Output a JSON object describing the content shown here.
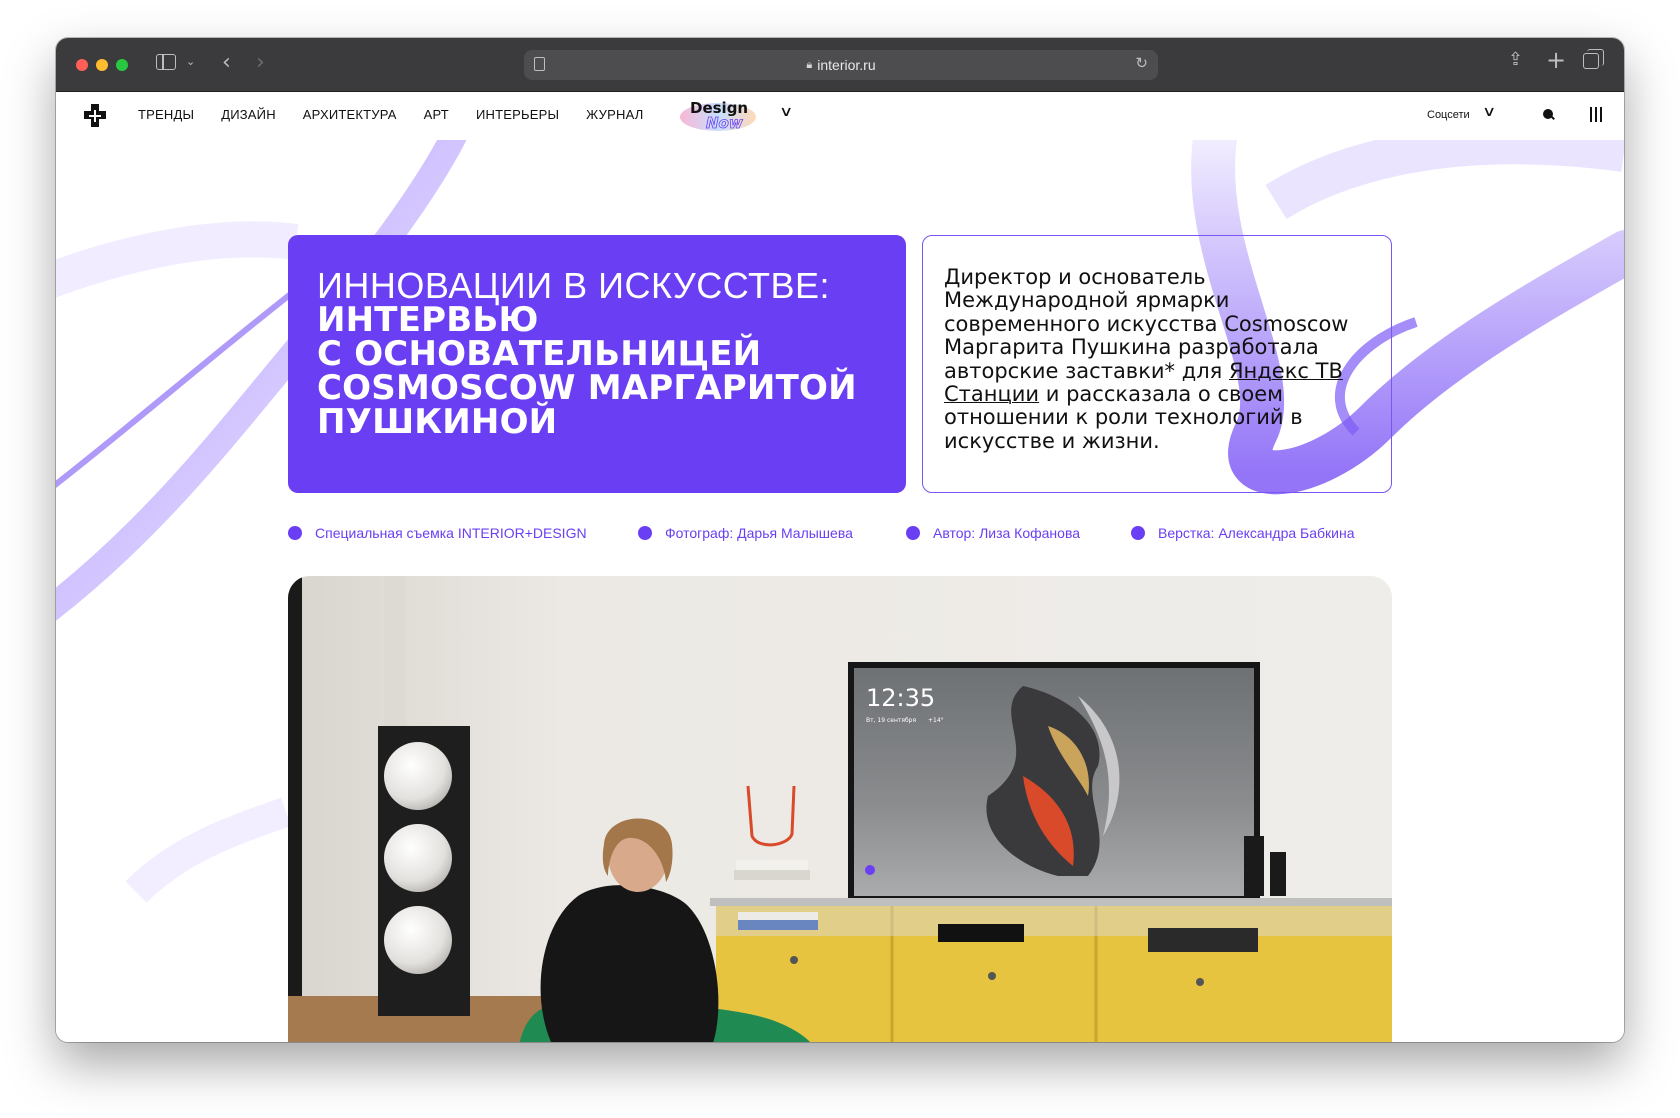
{
  "browser": {
    "url": "interior.ru",
    "icons": [
      "sidebar-icon",
      "chevron-down-icon",
      "back-icon",
      "forward-icon",
      "reader-icon",
      "lock-icon",
      "reload-icon",
      "share-icon",
      "new-tab-icon",
      "tabs-overview-icon"
    ]
  },
  "header": {
    "nav": [
      "ТРЕНДЫ",
      "ДИЗАЙН",
      "АРХИТЕКТУРА",
      "АРТ",
      "ИНТЕРЬЕРЫ",
      "ЖУРНАЛ"
    ],
    "badge_line1": "Design",
    "badge_line2": "Now",
    "socials_label": "Соцсети"
  },
  "hero": {
    "light_title": "ИННОВАЦИИ В ИСКУССТВЕ:",
    "bold_lines": [
      "ИНТЕРВЬЮ",
      "С ОСНОВАТЕЛЬНИЦЕЙ",
      "COSMOSCOW МАРГАРИТОЙ",
      "ПУШКИНОЙ"
    ],
    "lead_before": "Директор и основатель Международной ярмарки современного искусства Cosmoscow Маргарита Пушкина разработала авторские заставки* для ",
    "lead_link": "Яндекс ТВ Станции",
    "lead_after": " и рассказала о своем отношении к роли технологий в искусстве и жизни."
  },
  "credits": [
    "Специальная съемка INTERIOR+DESIGN",
    "Фотограф: Дарья Малышева",
    "Автор: Лиза Кофанова",
    "Верстка: Александра Бабкина"
  ],
  "photo": {
    "tv_clock": "12:35",
    "tv_date": "Вт, 19 сентября",
    "tv_weather": "+14°"
  },
  "colors": {
    "accent": "#6a3ff4",
    "toolbar": "#3b3b3d",
    "ribbon": "#8b6cf6"
  }
}
